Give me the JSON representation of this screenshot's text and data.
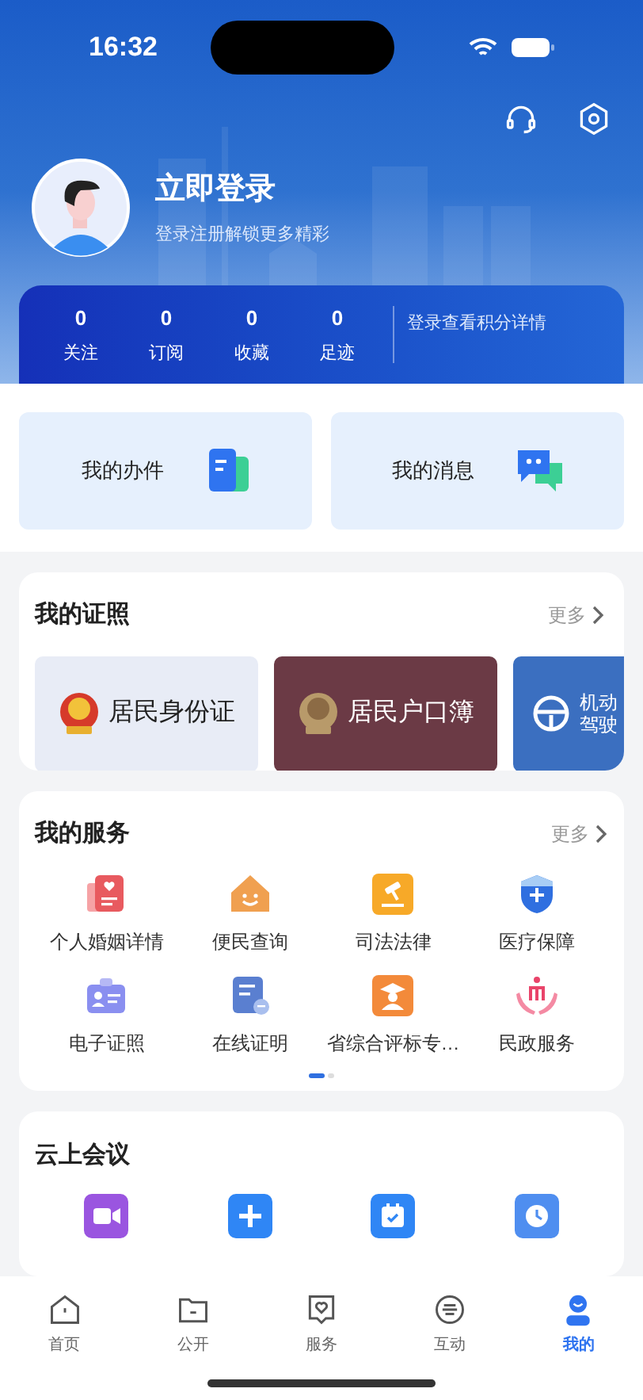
{
  "status_bar": {
    "time": "16:32"
  },
  "profile": {
    "title": "立即登录",
    "subtitle": "登录注册解锁更多精彩"
  },
  "stats": [
    {
      "value": "0",
      "label": "关注"
    },
    {
      "value": "0",
      "label": "订阅"
    },
    {
      "value": "0",
      "label": "收藏"
    },
    {
      "value": "0",
      "label": "足迹"
    }
  ],
  "points_hint": "登录查看积分详情",
  "quick_cards": [
    {
      "label": "我的办件",
      "kind": "document"
    },
    {
      "label": "我的消息",
      "kind": "message"
    }
  ],
  "certificates": {
    "title": "我的证照",
    "more": "更多",
    "items": [
      {
        "lines": [
          "居民身份证"
        ],
        "color": "#e8ecf6",
        "kind": "emblem"
      },
      {
        "lines": [
          "居民户口簿"
        ],
        "color": "#6b3a45",
        "kind": "emblem"
      },
      {
        "lines": [
          "机动",
          "驾驶"
        ],
        "color": "#3b6fc0",
        "kind": "wheel"
      }
    ]
  },
  "services": {
    "title": "我的服务",
    "more": "更多",
    "items": [
      {
        "label": "个人婚姻详情"
      },
      {
        "label": "便民查询"
      },
      {
        "label": "司法法律"
      },
      {
        "label": "医疗保障"
      },
      {
        "label": "电子证照"
      },
      {
        "label": "在线证明"
      },
      {
        "label": "省综合评标专…"
      },
      {
        "label": "民政服务"
      }
    ],
    "pages": [
      {
        "selected": true
      },
      {
        "selected": false
      }
    ]
  },
  "meetings": {
    "title": "云上会议"
  },
  "tab_bar": [
    {
      "label": "首页",
      "selected": false
    },
    {
      "label": "公开",
      "selected": false
    },
    {
      "label": "服务",
      "selected": false
    },
    {
      "label": "互动",
      "selected": false
    },
    {
      "label": "我的",
      "selected": true
    }
  ]
}
